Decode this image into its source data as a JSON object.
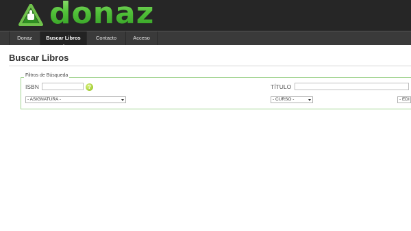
{
  "logo": {
    "text": "donaz",
    "icon": "recycle-thumbs-up-icon",
    "brand_color": "#3cae2a"
  },
  "nav": {
    "items": [
      {
        "label": "Donaz"
      },
      {
        "label": "Buscar Libros",
        "active": true
      },
      {
        "label": "Contacto"
      },
      {
        "label": "Acceso"
      }
    ]
  },
  "page": {
    "title": "Buscar Libros"
  },
  "filters": {
    "legend": "Filtros de Búsqueda",
    "isbn_label": "ISBN",
    "isbn_value": "",
    "help_icon": "help-question-icon",
    "titulo_label": "TÍTULO",
    "titulo_value": "",
    "asignatura_selected": "- ASIGNATURA -",
    "curso_selected": "- CURSO -",
    "editorial_selected": "- EDI"
  }
}
